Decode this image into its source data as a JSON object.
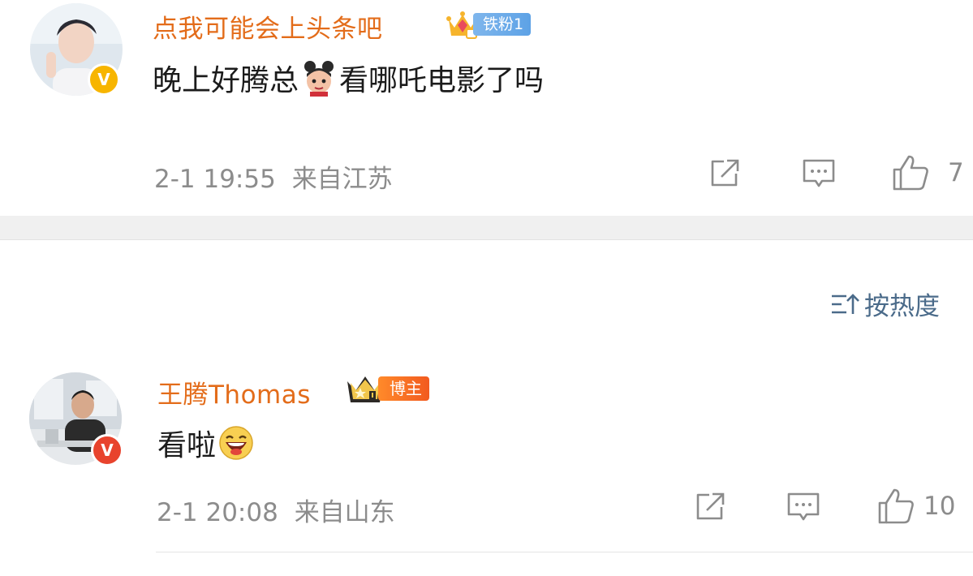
{
  "comments": [
    {
      "username": "点我可能会上头条吧",
      "badge": {
        "type": "fan",
        "label": "铁粉1",
        "icon": "diamond-crown-icon"
      },
      "verified_icon": "verified-v-icon",
      "verified_color": "#f7b500",
      "content_before": "晚上好腾总",
      "emoji": "nezha-emoji",
      "content_after": "看哪吒电影了吗",
      "time": "2-1 19:55",
      "location": "来自江苏",
      "like_count": "7"
    },
    {
      "username": "王腾Thomas",
      "badge": {
        "type": "host",
        "label": "博主",
        "icon": "crown-rank-icon"
      },
      "verified_icon": "verified-v-icon",
      "verified_color": "#e8432d",
      "content_before": "看啦",
      "emoji": "laughing-emoji",
      "time": "2-1 20:08",
      "location": "来自山东",
      "like_count": "10"
    }
  ],
  "sort": {
    "label": "按热度",
    "icon": "sort-icon"
  },
  "actions": {
    "share_icon": "share-icon",
    "comment_icon": "comment-icon",
    "like_icon": "thumbs-up-icon"
  },
  "colors": {
    "username": "#e36c1a",
    "meta": "#8c8c8c",
    "sort": "#4b6b8a",
    "fan_badge": "#6aa9e8",
    "host_badge": "#f56b22"
  }
}
